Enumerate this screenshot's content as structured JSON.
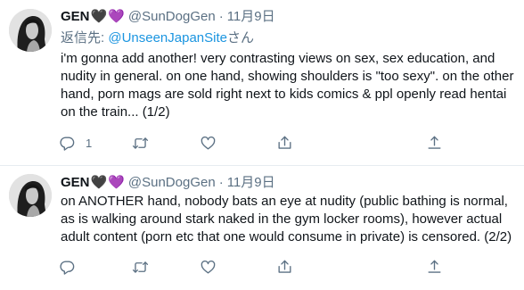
{
  "tweets": [
    {
      "author_name": "GEN",
      "handle": "@SunDogGen",
      "separator": "·",
      "time": "11月9日",
      "reply_prefix": "返信先: ",
      "reply_to": "@UnseenJapanSite",
      "reply_suffix": "さん",
      "text": "i'm gonna add another! very contrasting views on sex, sex education, and nudity in general. on one hand, showing shoulders is \"too sexy\". on the other hand, porn mags are sold right next to kids comics & ppl openly read hentai on the train... (1/2)",
      "reply_count": "1",
      "icons": [
        "reply-icon",
        "retweet-icon",
        "like-icon",
        "share-icon",
        "more-icon"
      ]
    },
    {
      "author_name": "GEN",
      "handle": "@SunDogGen",
      "separator": "·",
      "time": "11月9日",
      "text": "on ANOTHER hand, nobody bats an eye at nudity (public bathing is normal, as is walking around stark naked in the gym locker rooms), however actual adult content (porn etc that one would consume in private) is censored. (2/2)",
      "icons": [
        "reply-icon",
        "retweet-icon",
        "like-icon",
        "share-icon",
        "more-icon"
      ]
    }
  ],
  "name_emoji": [
    "🖤",
    "💜"
  ],
  "colors": {
    "text": "#0f1419",
    "secondary": "#5b7083",
    "link": "#1b95e0",
    "divider": "#e6ecf0",
    "purple_heart": "#a98be4"
  }
}
